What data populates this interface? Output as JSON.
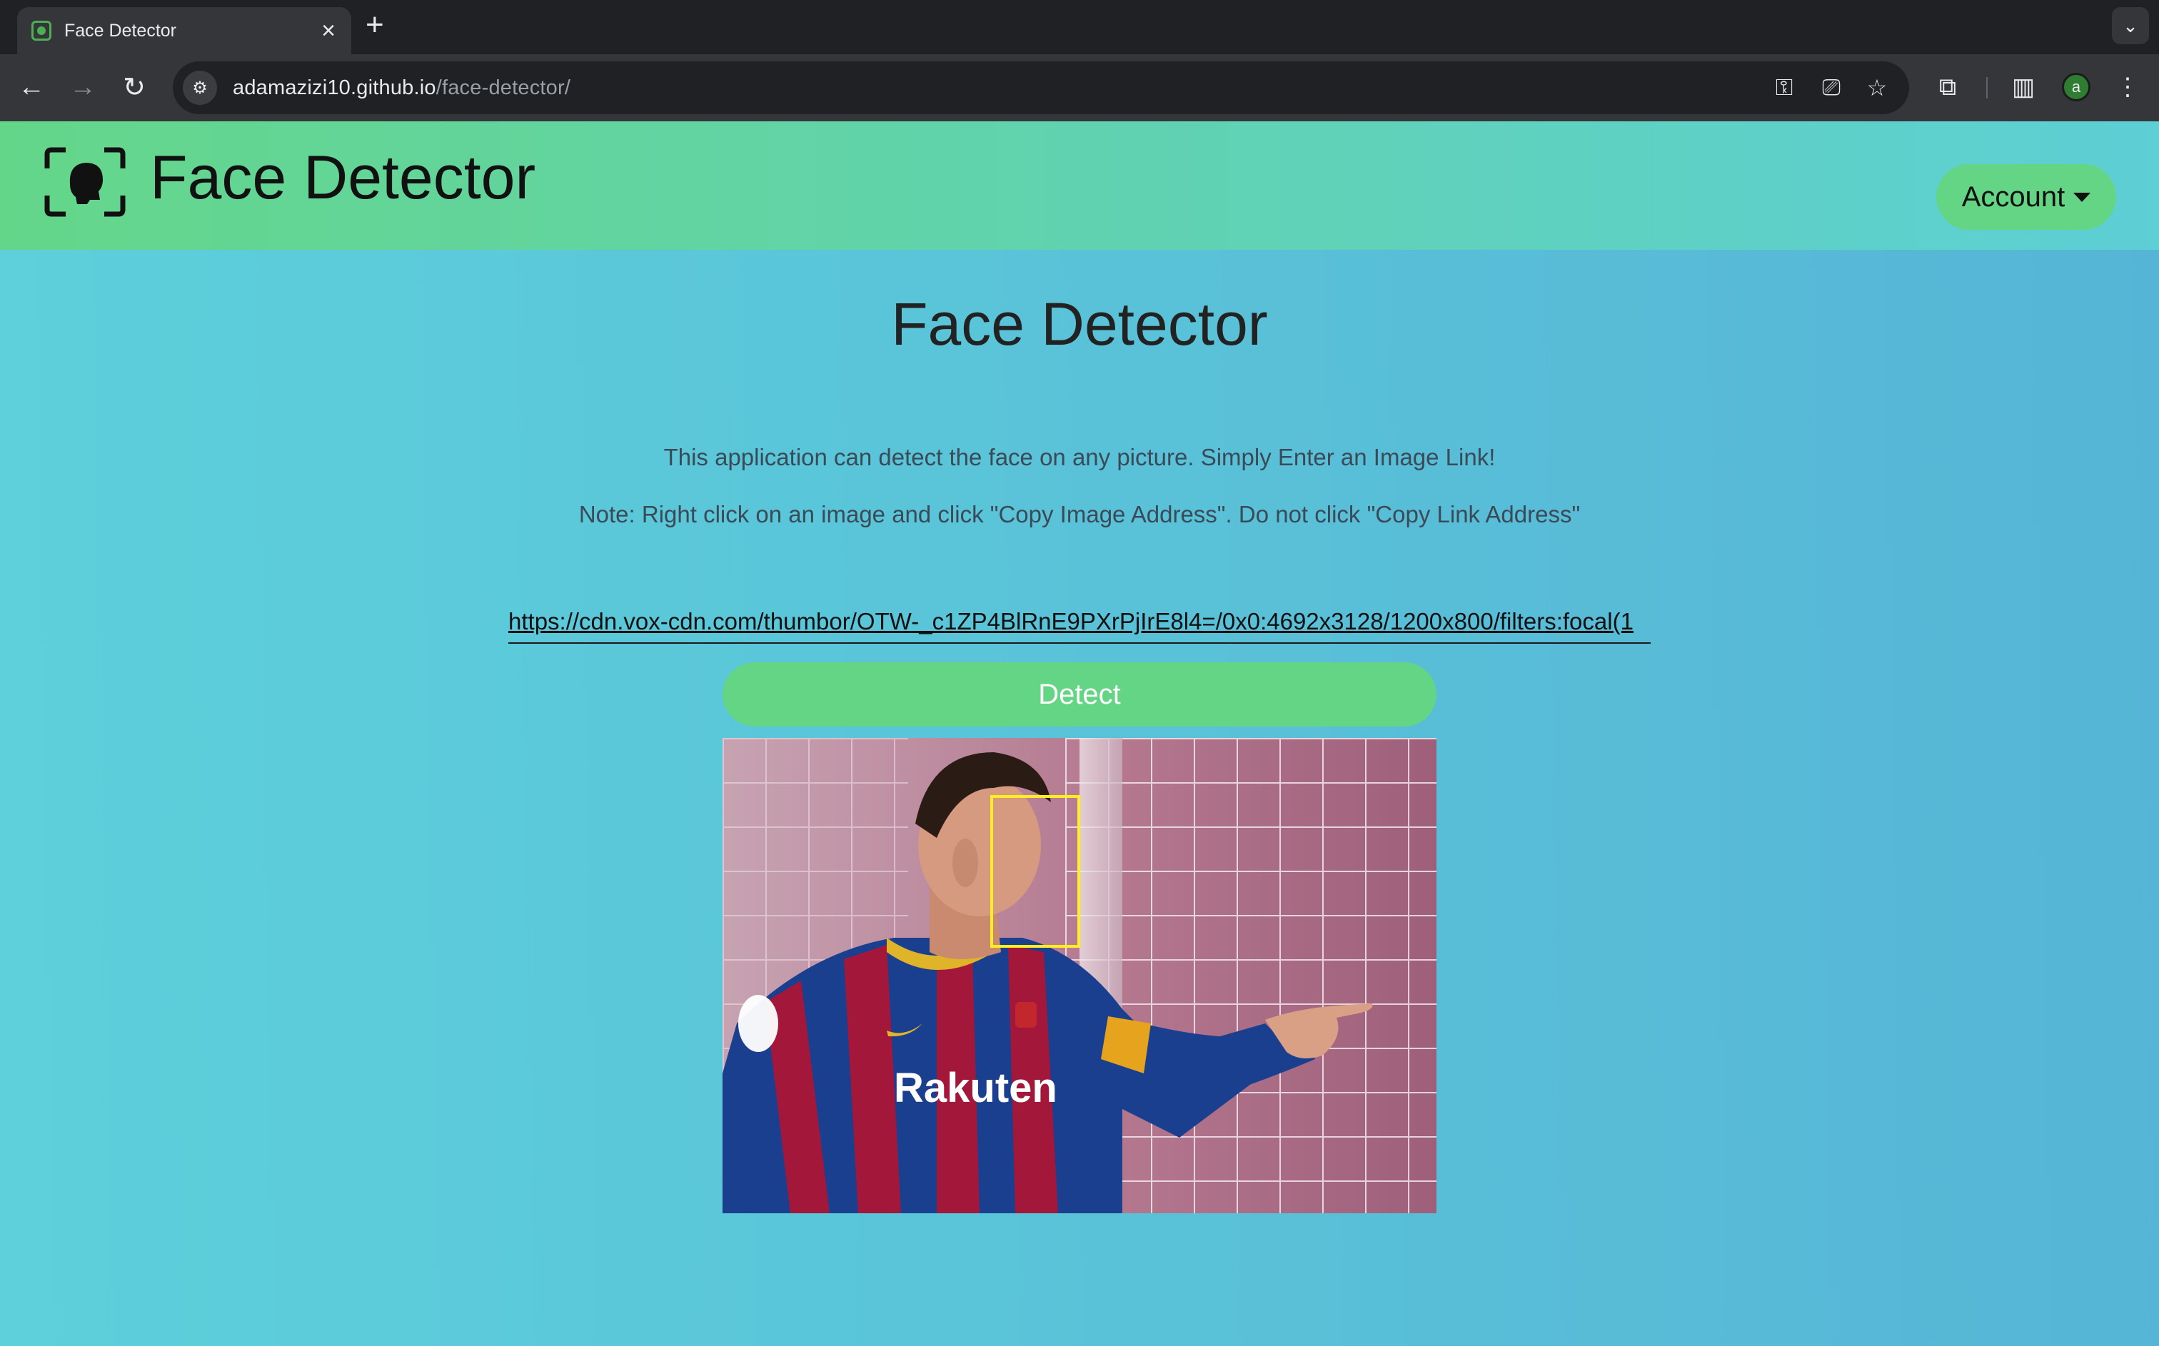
{
  "browser": {
    "tab_title": "Face Detector",
    "url_host": "adamazizi10.github.io",
    "url_path": "/face-detector/",
    "profile_initial": "a",
    "icons": [
      "face-favicon-icon",
      "close-icon",
      "plus-icon",
      "chevron-down-icon",
      "back-arrow-icon",
      "forward-arrow-icon",
      "reload-icon",
      "site-settings-icon",
      "key-icon",
      "install-app-icon",
      "star-icon",
      "extensions-icon",
      "side-panel-icon",
      "kebab-menu-icon"
    ]
  },
  "navbar": {
    "brand_name": "Face Detector",
    "account_label": "Account"
  },
  "main": {
    "title": "Face Detector",
    "description": "This application can detect the face on any picture. Simply Enter an Image Link!",
    "note": "Note: Right click on an image and click \"Copy Image Address\". Do not click \"Copy Link Address\"",
    "image_url_value": "https://cdn.vox-cdn.com/thumbor/OTW-_c1ZP4BlRnE9PXrPjIrE8l4=/0x0:4692x3128/1200x800/filters:focal(1",
    "detect_label": "Detect",
    "jersey_text": "Rakuten"
  },
  "colors": {
    "navbar_gradient": [
      "#64d68a",
      "#5dcfd5"
    ],
    "page_gradient": [
      "#5dd0db",
      "#56b5d6"
    ],
    "button": "#64d485",
    "face_box": "#ffee22"
  }
}
